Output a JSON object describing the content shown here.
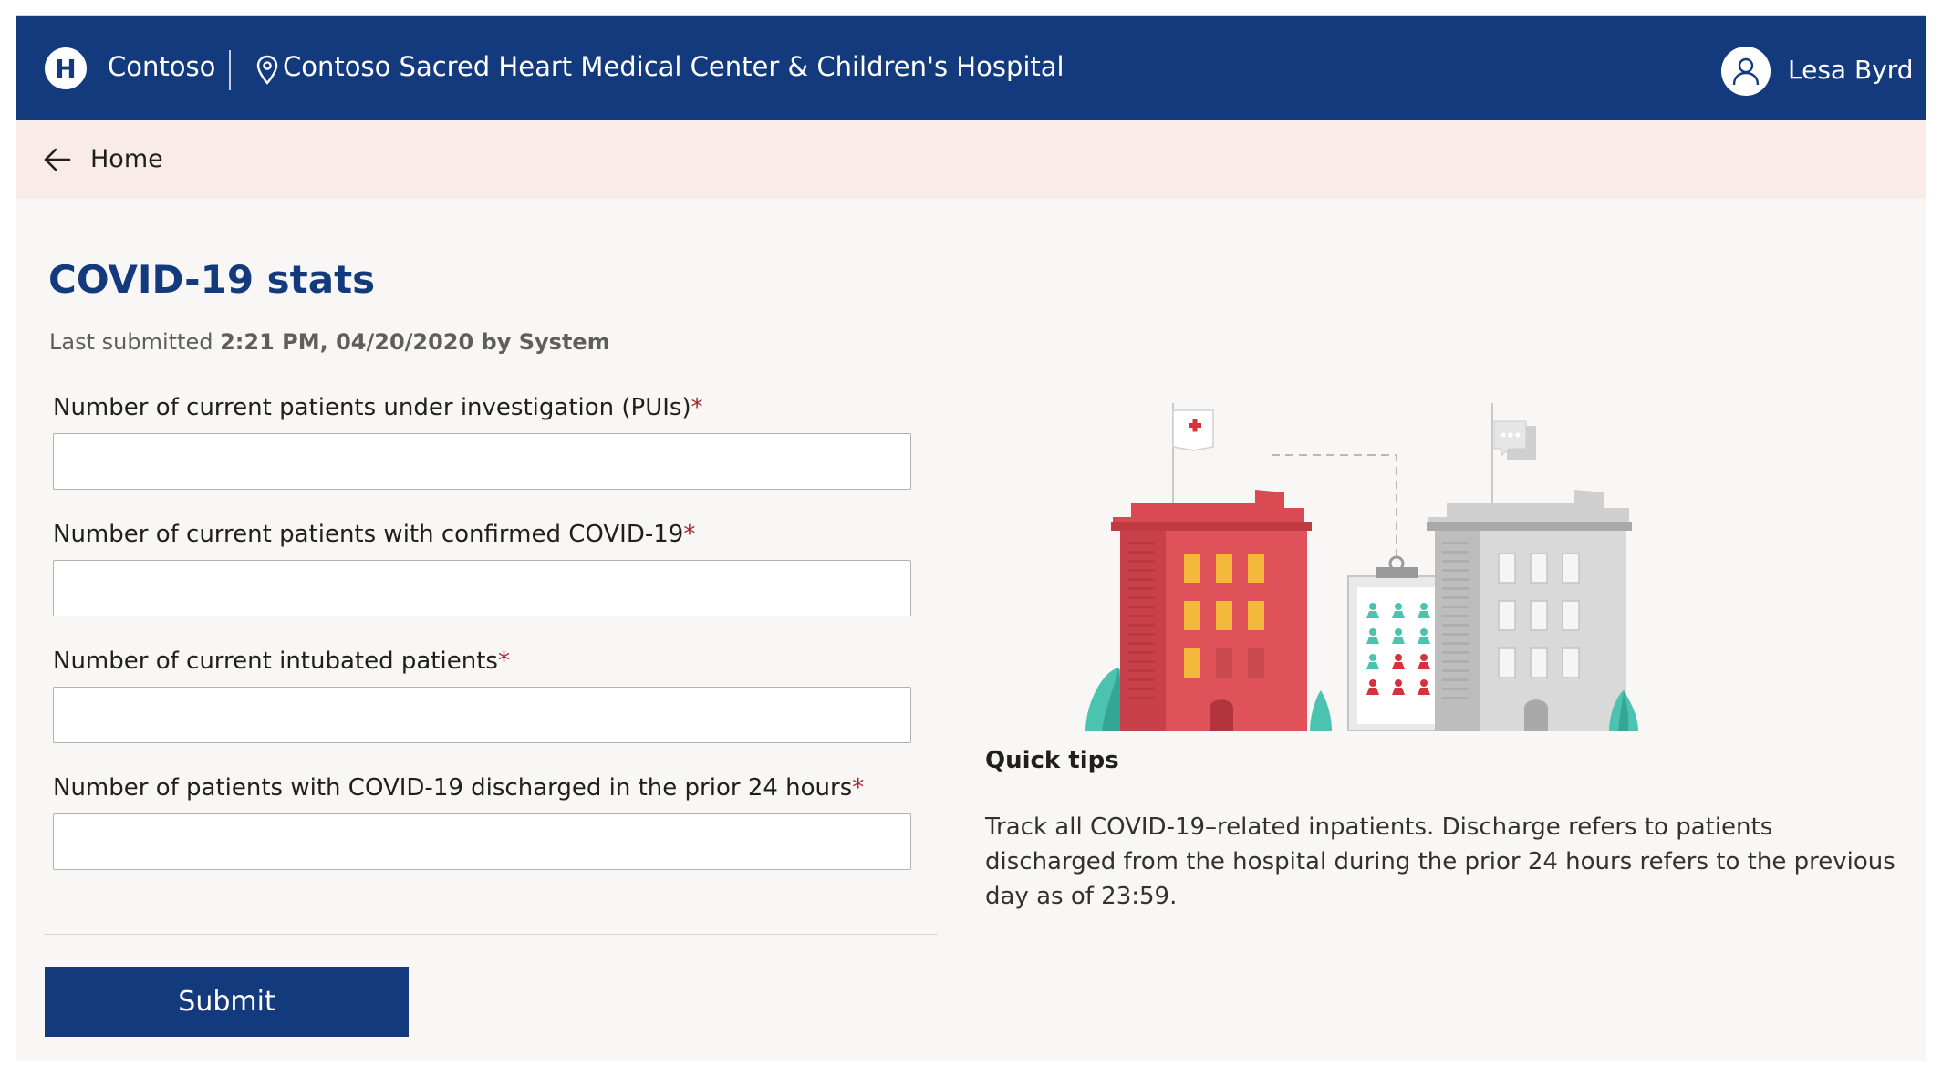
{
  "header": {
    "logo_letter": "H",
    "brand": "Contoso",
    "location": "Contoso Sacred Heart Medical Center & Children's Hospital",
    "user_name": "Lesa Byrd",
    "icons": [
      "location-pin-icon",
      "user-avatar-icon"
    ]
  },
  "breadcrumb": {
    "back_icon": "arrow-left-icon",
    "label": "Home"
  },
  "page": {
    "title": "COVID-19 stats",
    "last_submitted_prefix": "Last submitted",
    "last_submitted_value": "2:21 PM, 04/20/2020 by System"
  },
  "form": {
    "fields": [
      {
        "label": "Number of current patients under investigation (PUIs)",
        "required_mark": "*",
        "value": ""
      },
      {
        "label": "Number of current patients with confirmed COVID-19",
        "required_mark": "*",
        "value": ""
      },
      {
        "label": "Number of current intubated patients",
        "required_mark": "*",
        "value": ""
      },
      {
        "label": "Number of patients with COVID-19 discharged in the prior 24 hours",
        "required_mark": "*",
        "value": ""
      }
    ],
    "submit_label": "Submit"
  },
  "tips": {
    "title": "Quick tips",
    "body": "Track all COVID-19–related inpatients. Discharge refers to patients discharged from the hospital during the prior 24 hours refers to the previous day as of 23:59."
  },
  "colors": {
    "brand": "#133a7c",
    "breadcrumb_bg": "#f9ebe8",
    "page_bg": "#f8f7f6",
    "required": "#a4262c",
    "illustration_red": "#e0525a",
    "illustration_teal": "#4cc2b0",
    "illustration_gray": "#d3d3d3"
  }
}
